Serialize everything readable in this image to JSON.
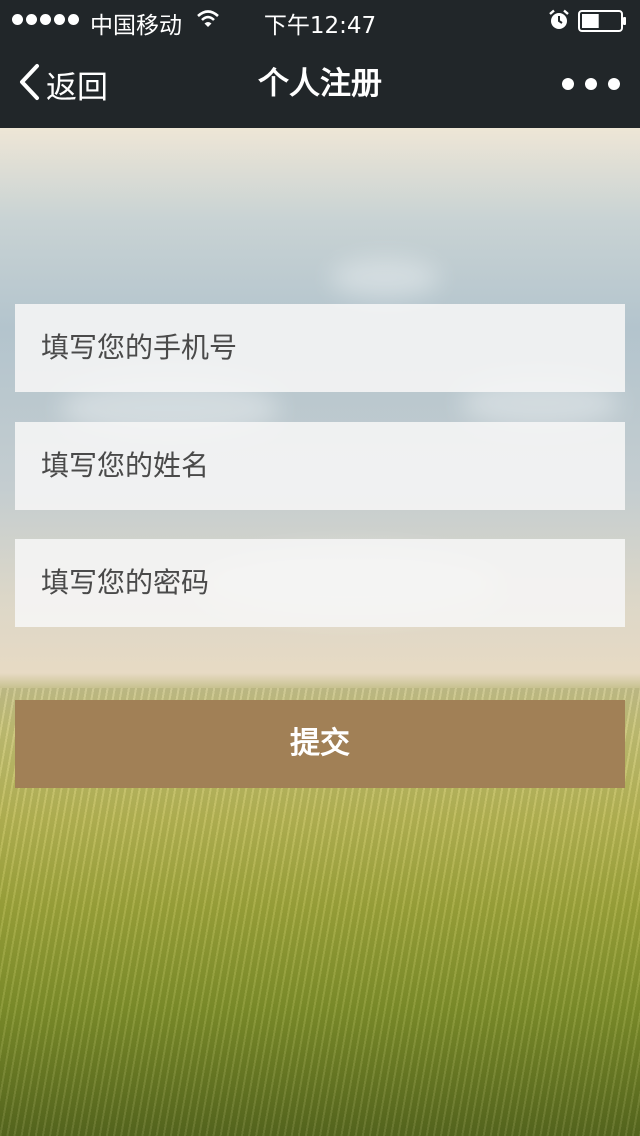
{
  "status_bar": {
    "carrier": "中国移动",
    "time": "下午12:47",
    "battery_level": 0.45
  },
  "nav": {
    "back_label": "返回",
    "title": "个人注册"
  },
  "form": {
    "phone_placeholder": "填写您的手机号",
    "name_placeholder": "填写您的姓名",
    "password_placeholder": "填写您的密码",
    "submit_label": "提交"
  },
  "colors": {
    "nav_background": "#212629",
    "submit_button": "#a18056"
  }
}
